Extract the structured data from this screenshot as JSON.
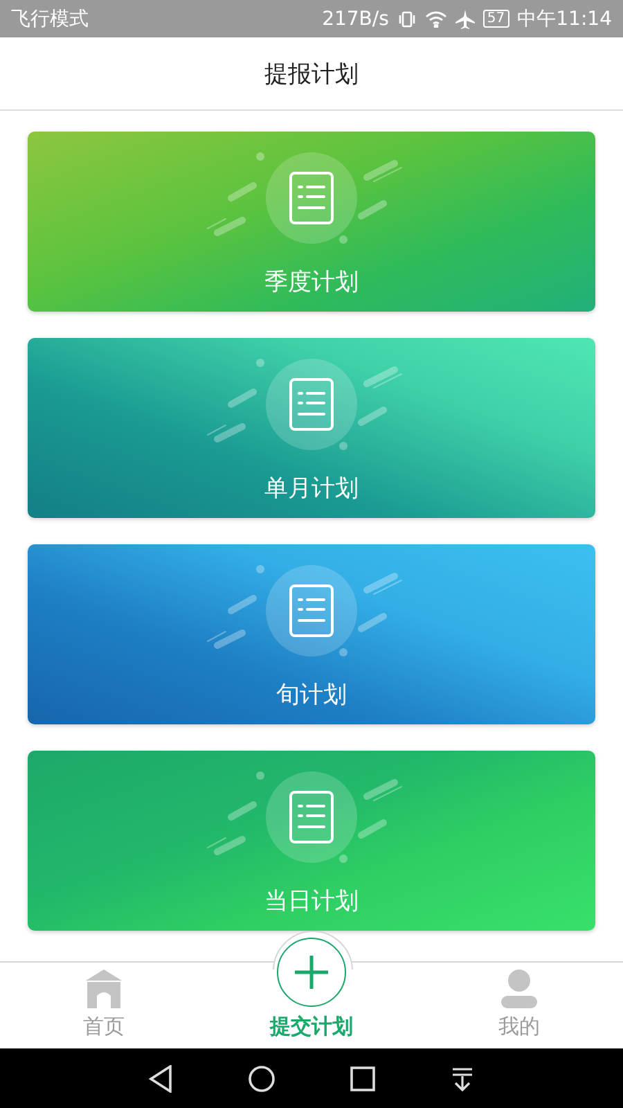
{
  "status_bar": {
    "mode": "飞行模式",
    "speed": "217B/s",
    "battery": "57",
    "time": "中午11:14"
  },
  "header": {
    "title": "提报计划"
  },
  "cards": [
    {
      "label": "季度计划",
      "kind": "lime"
    },
    {
      "label": "单月计划",
      "kind": "teal"
    },
    {
      "label": "旬计划",
      "kind": "blue"
    },
    {
      "label": "当日计划",
      "kind": "green"
    }
  ],
  "nav": [
    {
      "label": "首页",
      "kind": "home",
      "selected": false
    },
    {
      "label": "提交计划",
      "kind": "add",
      "selected": true
    },
    {
      "label": "我的",
      "kind": "profile",
      "selected": false
    }
  ]
}
